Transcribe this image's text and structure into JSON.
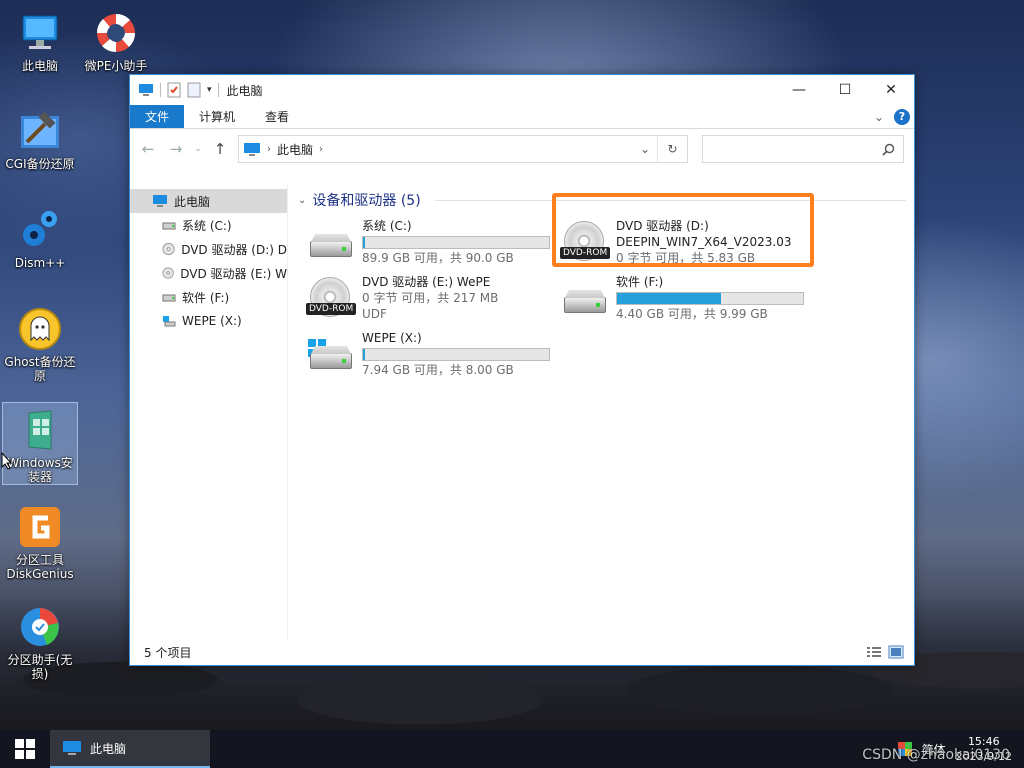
{
  "desktop": {
    "icons": [
      {
        "label": "此电脑",
        "icon": "computer-icon"
      },
      {
        "label": "微PE小助手",
        "icon": "lifebuoy-icon"
      },
      {
        "label": "CGI备份还原",
        "icon": "hammer-icon"
      },
      {
        "label": "Dism++",
        "icon": "gears-icon"
      },
      {
        "label": "Ghost备份还原",
        "icon": "ghost-icon"
      },
      {
        "label": "Windows安装器",
        "icon": "windows-installer-icon"
      },
      {
        "label": "分区工具DiskGenius",
        "icon": "diskgenius-icon"
      },
      {
        "label": "分区助手(无损)",
        "icon": "partition-assistant-icon"
      }
    ]
  },
  "window": {
    "title": "此电脑",
    "controls": {
      "minimize": "—",
      "maximize": "☐",
      "close": "✕"
    },
    "ribbon_tabs": [
      "文件",
      "计算机",
      "查看"
    ],
    "address": "此电脑",
    "search_placeholder": "",
    "sidebar": {
      "root": "此电脑",
      "items": [
        {
          "label": "系统 (C:)",
          "icon": "hard-drive-icon"
        },
        {
          "label": "DVD 驱动器 (D:) D",
          "icon": "dvd-icon"
        },
        {
          "label": "DVD 驱动器 (E:) W",
          "icon": "dvd-icon"
        },
        {
          "label": "软件 (F:)",
          "icon": "hard-drive-icon"
        },
        {
          "label": "WEPE (X:)",
          "icon": "network-drive-icon"
        }
      ]
    },
    "group_title": "设备和驱动器 (5)",
    "drives": [
      {
        "name": "系统 (C:)",
        "info": "89.9 GB 可用，共 90.0 GB",
        "used_fraction": 0.01,
        "type": "hdd"
      },
      {
        "name": "DVD 驱动器 (D:)",
        "volume": "DEEPIN_WIN7_X64_V2023.03",
        "info": "0 字节 可用，共 5.83 GB",
        "type": "dvd",
        "badge": "DVD-ROM",
        "highlighted": true
      },
      {
        "name": "DVD 驱动器 (E:) WePE",
        "info": "0 字节 可用，共 217 MB",
        "fs": "UDF",
        "type": "dvd",
        "badge": "DVD-ROM"
      },
      {
        "name": "软件 (F:)",
        "info": "4.40 GB 可用，共 9.99 GB",
        "used_fraction": 0.56,
        "type": "hdd"
      },
      {
        "name": "WEPE (X:)",
        "info": "7.94 GB 可用，共 8.00 GB",
        "used_fraction": 0.01,
        "type": "system-hdd"
      }
    ],
    "status": "5 个项目"
  },
  "taskbar": {
    "task_label": "此电脑",
    "ime": "简体",
    "time": "15:46",
    "date": "2023/9/12"
  },
  "watermark": "CSDN @zhaokai0130",
  "colors": {
    "accent": "#1979ca",
    "highlight": "#ff7f1e",
    "bar_fill": "#26a0da"
  }
}
